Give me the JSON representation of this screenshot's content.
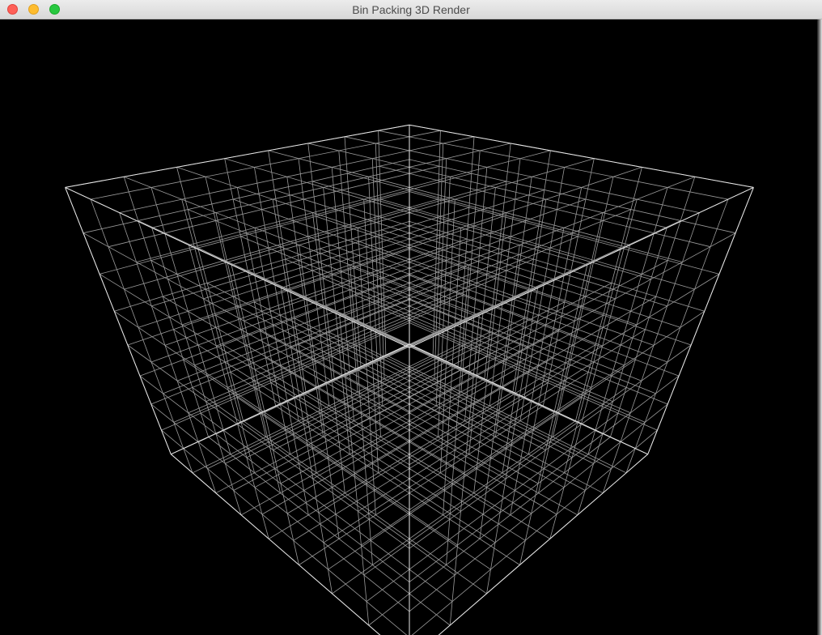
{
  "window": {
    "title": "Bin Packing 3D Render",
    "controls": [
      "close",
      "minimize",
      "zoom"
    ]
  },
  "scene": {
    "type": "wireframe-grid-cube",
    "background": "#000000",
    "line_color": "#e8e8e8",
    "divisions": 8
  }
}
